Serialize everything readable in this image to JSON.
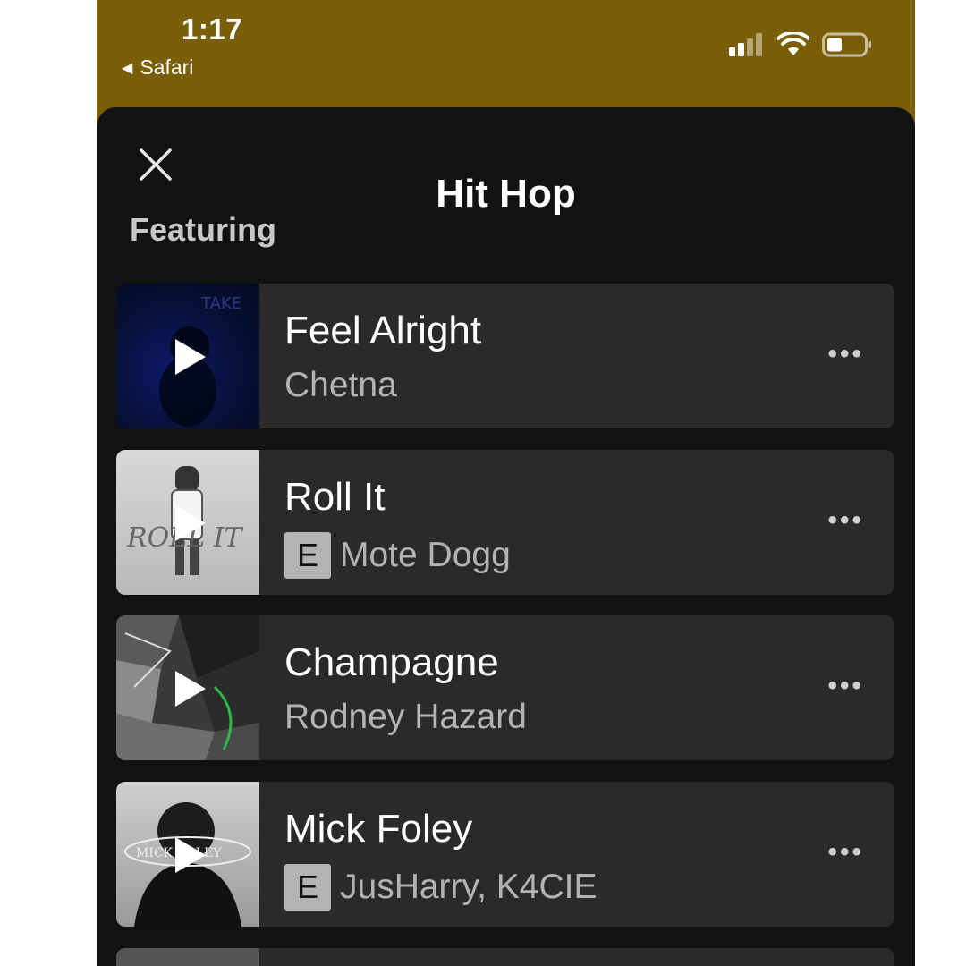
{
  "status_bar": {
    "time": "1:17",
    "back_app": "Safari"
  },
  "sheet": {
    "title": "Hit Hop",
    "section_label": "Featuring"
  },
  "tracks": [
    {
      "title": "Feel Alright",
      "artist": "Chetna",
      "explicit": false,
      "art_icon": "album-art-blue"
    },
    {
      "title": "Roll It",
      "artist": "Mote Dogg",
      "explicit": true,
      "badge": "E",
      "art_icon": "album-art-roll-it"
    },
    {
      "title": "Champagne",
      "artist": "Rodney Hazard",
      "explicit": false,
      "art_icon": "album-art-collage"
    },
    {
      "title": "Mick Foley",
      "artist": "JusHarry, K4CIE",
      "explicit": true,
      "badge": "E",
      "art_icon": "album-art-bw-portrait"
    }
  ],
  "colors": {
    "status_bg": "#7a5e08",
    "sheet_bg": "#121212",
    "row_bg": "#2a2a2a",
    "title_text": "#ffffff",
    "sub_text": "#b3b3b3"
  }
}
